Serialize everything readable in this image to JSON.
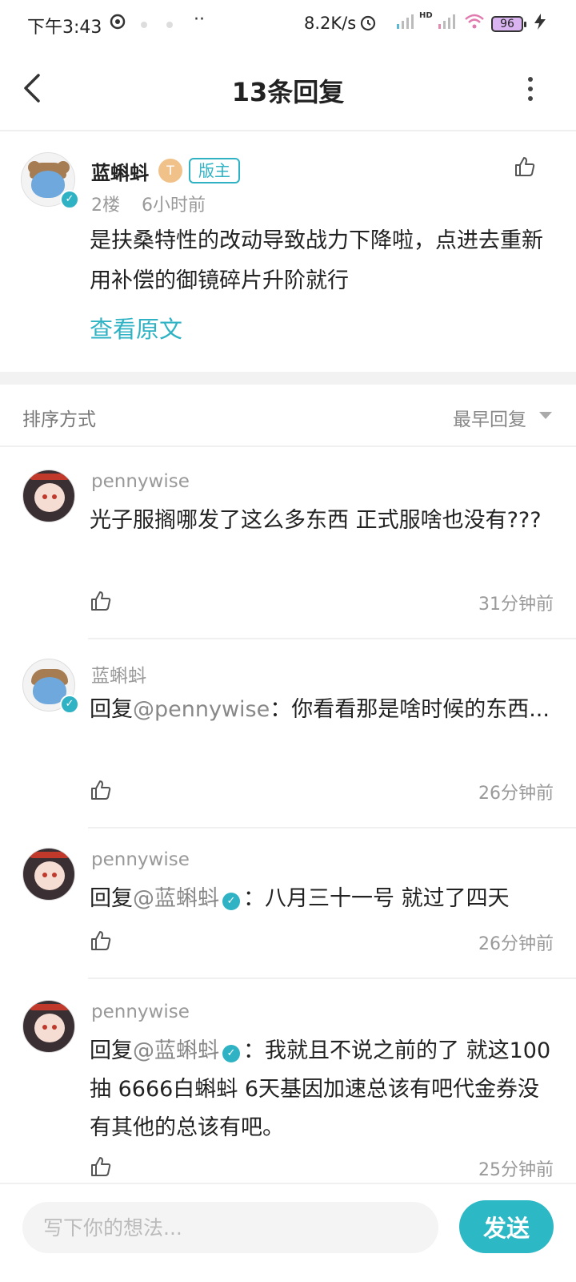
{
  "status_bar": {
    "time": "下午3:43",
    "net_speed": "8.2K/s",
    "battery": "96",
    "signal_hd": "HD"
  },
  "header": {
    "title": "13条回复"
  },
  "original_post": {
    "author": "蓝蝌蚪",
    "level_badge": "T",
    "role_tag": "版主",
    "floor": "2楼",
    "time": "6小时前",
    "text": "是扶桑特性的改动导致战力下降啦，点进去重新用补偿的御镜碎片升阶就行",
    "view_original": "查看原文"
  },
  "sort": {
    "label": "排序方式",
    "value": "最早回复"
  },
  "comments": [
    {
      "author": "pennywise",
      "text": "光子服搁哪发了这么多东西 正式服啥也没有???",
      "time": "31分钟前"
    },
    {
      "author": "蓝蝌蚪",
      "reply_prefix": "回复",
      "reply_to": "@pennywise",
      "text": "：你看看那是啥时候的东西...",
      "time": "26分钟前"
    },
    {
      "author": "pennywise",
      "reply_prefix": "回复",
      "reply_to": "@蓝蝌蚪",
      "text": "：八月三十一号 就过了四天",
      "time": "26分钟前"
    },
    {
      "author": "pennywise",
      "reply_prefix": "回复",
      "reply_to": "@蓝蝌蚪",
      "text": "：我就且不说之前的了 就这100抽 6666白蝌蚪 6天基因加速总该有吧代金券没有其他的总该有吧。",
      "time": "25分钟前"
    }
  ],
  "input_bar": {
    "placeholder": "写下你的想法...",
    "send_label": "发送"
  },
  "colors": {
    "accent": "#2fb3c4",
    "send_button": "#2db8c5"
  }
}
